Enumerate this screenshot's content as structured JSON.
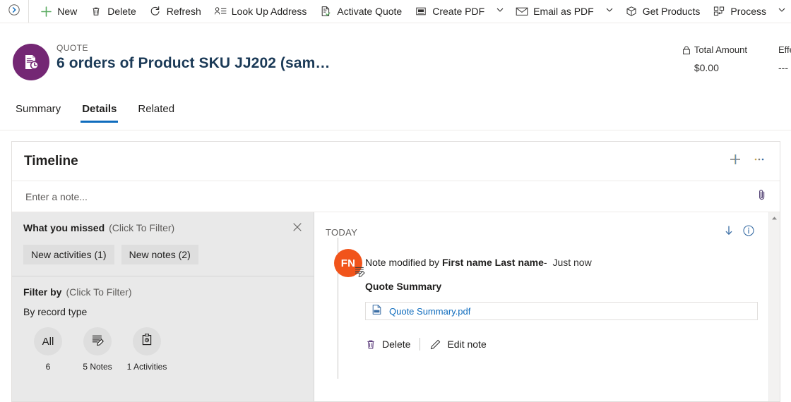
{
  "commandbar": {
    "collapse_icon": "chevron-right-circle-icon",
    "items": [
      {
        "label": "New",
        "icon": "plus-icon",
        "caret": false
      },
      {
        "label": "Delete",
        "icon": "trash-icon",
        "caret": false
      },
      {
        "label": "Refresh",
        "icon": "refresh-icon",
        "caret": false
      },
      {
        "label": "Look Up Address",
        "icon": "address-lookup-icon",
        "caret": false
      },
      {
        "label": "Activate Quote",
        "icon": "document-check-icon",
        "caret": false
      },
      {
        "label": "Create PDF",
        "icon": "pdf-icon",
        "caret": true
      },
      {
        "label": "Email as PDF",
        "icon": "mail-icon",
        "caret": true
      },
      {
        "label": "Get Products",
        "icon": "box-icon",
        "caret": false
      },
      {
        "label": "Process",
        "icon": "process-icon",
        "caret": true
      }
    ]
  },
  "record_header": {
    "entity_label": "QUOTE",
    "record_name": "6 orders of Product SKU JJ202 (sam…",
    "icon": "quote-document-clock-icon",
    "fields": [
      {
        "label": "Total Amount",
        "value": "$0.00",
        "locked": true,
        "lock_icon": "lock-icon"
      },
      {
        "label": "Effe",
        "value": "---",
        "locked": false,
        "truncated": true
      }
    ]
  },
  "tabs": {
    "items": [
      {
        "label": "Summary",
        "active": false
      },
      {
        "label": "Details",
        "active": true
      },
      {
        "label": "Related",
        "active": false
      }
    ],
    "active_underline_color": "#0f6cbd"
  },
  "timeline": {
    "title": "Timeline",
    "add_icon": "plus-icon",
    "more_icon": "ellipsis-icon",
    "note_placeholder": "Enter a note...",
    "attach_icon": "paperclip-icon",
    "what_you_missed": {
      "title": "What you missed",
      "subtitle": "(Click To Filter)",
      "close_icon": "close-icon",
      "chips": [
        {
          "label": "New activities (1)"
        },
        {
          "label": "New notes (2)"
        }
      ]
    },
    "filter_by": {
      "title": "Filter by",
      "subtitle": "(Click To Filter)",
      "group_label": "By record type",
      "record_types": [
        {
          "glyph": "All",
          "icon": "",
          "count_label": "6"
        },
        {
          "glyph": "",
          "icon": "note-pencil-icon",
          "count_label": "5 Notes"
        },
        {
          "glyph": "",
          "icon": "clipboard-activity-icon",
          "count_label": "1 Activities"
        }
      ]
    },
    "content": {
      "group_label": "TODAY",
      "jump_icon": "arrow-down-icon",
      "info_icon": "info-circle-icon",
      "entries": [
        {
          "avatar_initials": "FN",
          "avatar_color": "#f1541b",
          "badge_icon": "note-pencil-icon",
          "meta_prefix": "Note modified by",
          "meta_author": "First name Last name",
          "meta_dash": "-",
          "meta_time": "Just now",
          "subject": "Quote Summary",
          "attachment": {
            "name": "Quote Summary.pdf",
            "icon": "pdf-file-icon"
          },
          "actions": [
            {
              "label": "Delete",
              "icon": "trash-icon"
            },
            {
              "label": "Edit note",
              "icon": "pencil-icon"
            }
          ]
        }
      ]
    },
    "scrollbar": {
      "up_icon": "caret-up-icon"
    }
  },
  "theme": {
    "accent_blue": "#0f6cbd",
    "entity_purple": "#742774",
    "avatar_orange": "#f1541b",
    "new_green": "#5aab61",
    "panel_gray": "#e9e9e9"
  }
}
